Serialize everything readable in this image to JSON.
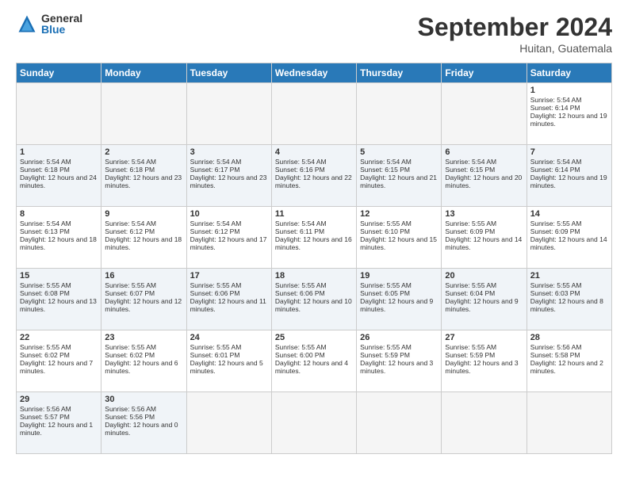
{
  "logo": {
    "general": "General",
    "blue": "Blue"
  },
  "title": "September 2024",
  "location": "Huitan, Guatemala",
  "days": [
    "Sunday",
    "Monday",
    "Tuesday",
    "Wednesday",
    "Thursday",
    "Friday",
    "Saturday"
  ],
  "cells": [
    [
      {
        "day": "",
        "empty": true
      },
      {
        "day": "",
        "empty": true
      },
      {
        "day": "",
        "empty": true
      },
      {
        "day": "",
        "empty": true
      },
      {
        "day": "",
        "empty": true
      },
      {
        "day": "",
        "empty": true
      },
      {
        "num": "1",
        "sunrise": "Sunrise: 5:54 AM",
        "sunset": "Sunset: 6:14 PM",
        "daylight": "Daylight: 12 hours and 19 minutes."
      }
    ],
    [
      {
        "num": "1",
        "sunrise": "Sunrise: 5:54 AM",
        "sunset": "Sunset: 6:18 PM",
        "daylight": "Daylight: 12 hours and 24 minutes."
      },
      {
        "num": "2",
        "sunrise": "Sunrise: 5:54 AM",
        "sunset": "Sunset: 6:18 PM",
        "daylight": "Daylight: 12 hours and 23 minutes."
      },
      {
        "num": "3",
        "sunrise": "Sunrise: 5:54 AM",
        "sunset": "Sunset: 6:17 PM",
        "daylight": "Daylight: 12 hours and 23 minutes."
      },
      {
        "num": "4",
        "sunrise": "Sunrise: 5:54 AM",
        "sunset": "Sunset: 6:16 PM",
        "daylight": "Daylight: 12 hours and 22 minutes."
      },
      {
        "num": "5",
        "sunrise": "Sunrise: 5:54 AM",
        "sunset": "Sunset: 6:15 PM",
        "daylight": "Daylight: 12 hours and 21 minutes."
      },
      {
        "num": "6",
        "sunrise": "Sunrise: 5:54 AM",
        "sunset": "Sunset: 6:15 PM",
        "daylight": "Daylight: 12 hours and 20 minutes."
      },
      {
        "num": "7",
        "sunrise": "Sunrise: 5:54 AM",
        "sunset": "Sunset: 6:14 PM",
        "daylight": "Daylight: 12 hours and 19 minutes."
      }
    ],
    [
      {
        "num": "8",
        "sunrise": "Sunrise: 5:54 AM",
        "sunset": "Sunset: 6:13 PM",
        "daylight": "Daylight: 12 hours and 18 minutes."
      },
      {
        "num": "9",
        "sunrise": "Sunrise: 5:54 AM",
        "sunset": "Sunset: 6:12 PM",
        "daylight": "Daylight: 12 hours and 18 minutes."
      },
      {
        "num": "10",
        "sunrise": "Sunrise: 5:54 AM",
        "sunset": "Sunset: 6:12 PM",
        "daylight": "Daylight: 12 hours and 17 minutes."
      },
      {
        "num": "11",
        "sunrise": "Sunrise: 5:54 AM",
        "sunset": "Sunset: 6:11 PM",
        "daylight": "Daylight: 12 hours and 16 minutes."
      },
      {
        "num": "12",
        "sunrise": "Sunrise: 5:55 AM",
        "sunset": "Sunset: 6:10 PM",
        "daylight": "Daylight: 12 hours and 15 minutes."
      },
      {
        "num": "13",
        "sunrise": "Sunrise: 5:55 AM",
        "sunset": "Sunset: 6:09 PM",
        "daylight": "Daylight: 12 hours and 14 minutes."
      },
      {
        "num": "14",
        "sunrise": "Sunrise: 5:55 AM",
        "sunset": "Sunset: 6:09 PM",
        "daylight": "Daylight: 12 hours and 14 minutes."
      }
    ],
    [
      {
        "num": "15",
        "sunrise": "Sunrise: 5:55 AM",
        "sunset": "Sunset: 6:08 PM",
        "daylight": "Daylight: 12 hours and 13 minutes."
      },
      {
        "num": "16",
        "sunrise": "Sunrise: 5:55 AM",
        "sunset": "Sunset: 6:07 PM",
        "daylight": "Daylight: 12 hours and 12 minutes."
      },
      {
        "num": "17",
        "sunrise": "Sunrise: 5:55 AM",
        "sunset": "Sunset: 6:06 PM",
        "daylight": "Daylight: 12 hours and 11 minutes."
      },
      {
        "num": "18",
        "sunrise": "Sunrise: 5:55 AM",
        "sunset": "Sunset: 6:06 PM",
        "daylight": "Daylight: 12 hours and 10 minutes."
      },
      {
        "num": "19",
        "sunrise": "Sunrise: 5:55 AM",
        "sunset": "Sunset: 6:05 PM",
        "daylight": "Daylight: 12 hours and 9 minutes."
      },
      {
        "num": "20",
        "sunrise": "Sunrise: 5:55 AM",
        "sunset": "Sunset: 6:04 PM",
        "daylight": "Daylight: 12 hours and 9 minutes."
      },
      {
        "num": "21",
        "sunrise": "Sunrise: 5:55 AM",
        "sunset": "Sunset: 6:03 PM",
        "daylight": "Daylight: 12 hours and 8 minutes."
      }
    ],
    [
      {
        "num": "22",
        "sunrise": "Sunrise: 5:55 AM",
        "sunset": "Sunset: 6:02 PM",
        "daylight": "Daylight: 12 hours and 7 minutes."
      },
      {
        "num": "23",
        "sunrise": "Sunrise: 5:55 AM",
        "sunset": "Sunset: 6:02 PM",
        "daylight": "Daylight: 12 hours and 6 minutes."
      },
      {
        "num": "24",
        "sunrise": "Sunrise: 5:55 AM",
        "sunset": "Sunset: 6:01 PM",
        "daylight": "Daylight: 12 hours and 5 minutes."
      },
      {
        "num": "25",
        "sunrise": "Sunrise: 5:55 AM",
        "sunset": "Sunset: 6:00 PM",
        "daylight": "Daylight: 12 hours and 4 minutes."
      },
      {
        "num": "26",
        "sunrise": "Sunrise: 5:55 AM",
        "sunset": "Sunset: 5:59 PM",
        "daylight": "Daylight: 12 hours and 3 minutes."
      },
      {
        "num": "27",
        "sunrise": "Sunrise: 5:55 AM",
        "sunset": "Sunset: 5:59 PM",
        "daylight": "Daylight: 12 hours and 3 minutes."
      },
      {
        "num": "28",
        "sunrise": "Sunrise: 5:56 AM",
        "sunset": "Sunset: 5:58 PM",
        "daylight": "Daylight: 12 hours and 2 minutes."
      }
    ],
    [
      {
        "num": "29",
        "sunrise": "Sunrise: 5:56 AM",
        "sunset": "Sunset: 5:57 PM",
        "daylight": "Daylight: 12 hours and 1 minute."
      },
      {
        "num": "30",
        "sunrise": "Sunrise: 5:56 AM",
        "sunset": "Sunset: 5:56 PM",
        "daylight": "Daylight: 12 hours and 0 minutes."
      },
      {
        "day": "",
        "empty": true
      },
      {
        "day": "",
        "empty": true
      },
      {
        "day": "",
        "empty": true
      },
      {
        "day": "",
        "empty": true
      },
      {
        "day": "",
        "empty": true
      }
    ]
  ]
}
